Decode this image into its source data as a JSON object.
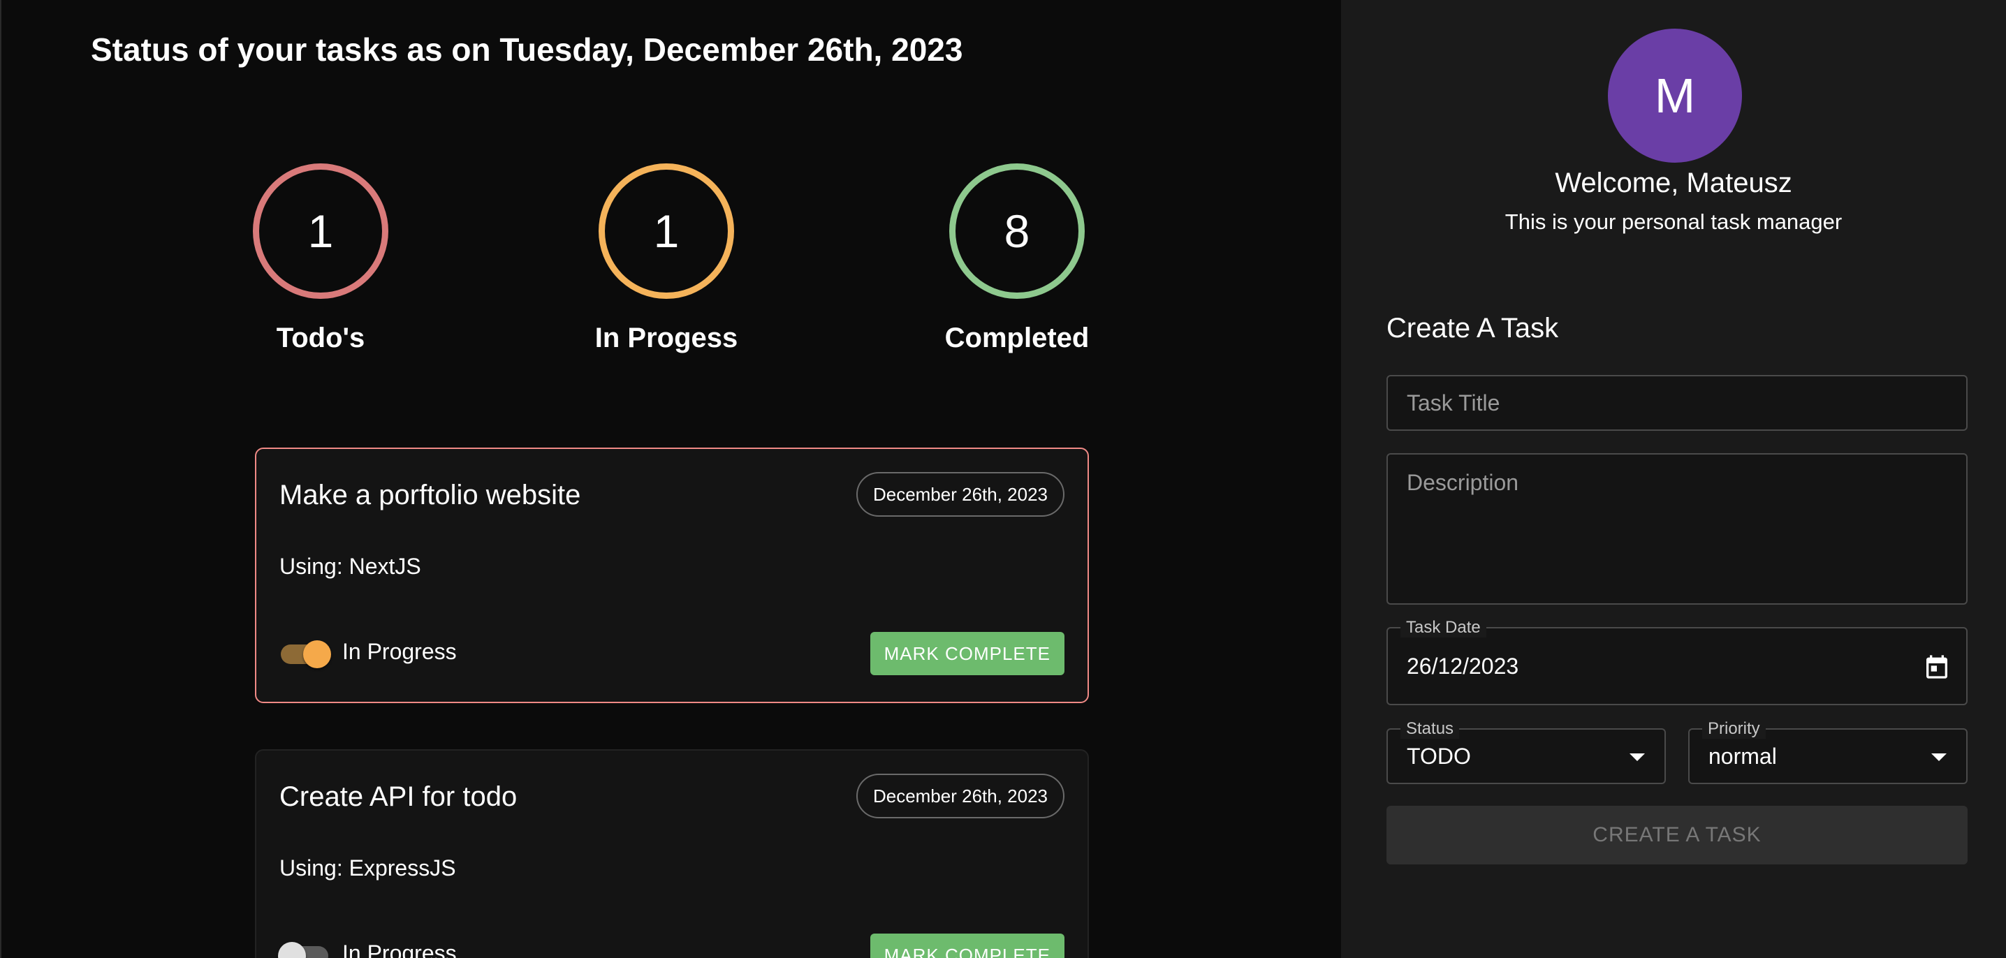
{
  "header": {
    "title": "Status of your tasks as on Tuesday, December 26th, 2023"
  },
  "stats": [
    {
      "count": "1",
      "label": "Todo's",
      "color": "#d97a7a"
    },
    {
      "count": "1",
      "label": "In Progess",
      "color": "#f5b35a"
    },
    {
      "count": "8",
      "label": "Completed",
      "color": "#8ec98e"
    }
  ],
  "tasks": [
    {
      "title": "Make a porftolio website",
      "date": "December 26th, 2023",
      "description": "Using: NextJS",
      "toggle_label": "In Progress",
      "toggle_on": true,
      "action": "MARK COMPLETE",
      "highlight_color": "#f08a86"
    },
    {
      "title": "Create API for todo",
      "date": "December 26th, 2023",
      "description": "Using: ExpressJS",
      "toggle_label": "In Progress",
      "toggle_on": false,
      "action": "MARK COMPLETE"
    }
  ],
  "sidebar": {
    "avatar_initial": "M",
    "avatar_color": "#6a3ea6",
    "welcome": "Welcome, Mateusz",
    "subtitle": "This is your personal task manager",
    "form": {
      "heading": "Create A Task",
      "title_placeholder": "Task Title",
      "description_placeholder": "Description",
      "date_label": "Task Date",
      "date_value": "26/12/2023",
      "status_label": "Status",
      "status_value": "TODO",
      "priority_label": "Priority",
      "priority_value": "normal",
      "submit_label": "CREATE A TASK"
    }
  },
  "icons": {
    "date_picker": "calendar-icon",
    "dropdown": "chevron-down-icon"
  }
}
